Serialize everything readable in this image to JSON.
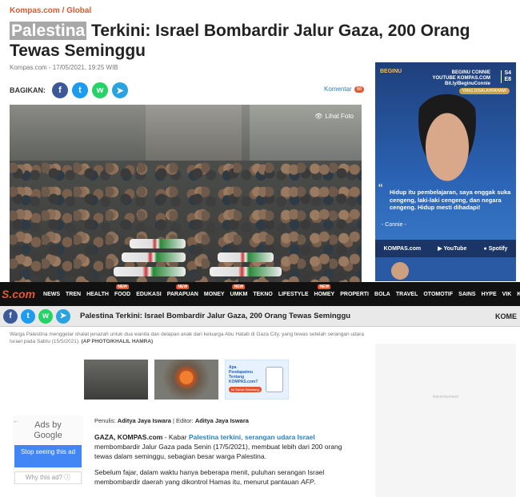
{
  "breadcrumb": {
    "site": "Kompas.com",
    "section": "Global"
  },
  "article": {
    "title_highlight": "Palestina",
    "title_rest": " Terkini: Israel Bombardir Jalur Gaza, 200 Orang Tewas Seminggu",
    "meta": "Kompas.com - 17/05/2021, 19:25 WIB",
    "share_label": "BAGIKAN:",
    "comment_label": "Komentar",
    "comment_count": "68",
    "photo_link": "Lihat Foto",
    "caption_text": "Warga Palestina menggelar shalat jenazah untuk dua wanita dan delapan anak dari keluarga Abu Hatab di Gaza City, yang tewas setelah serangan udara Israel pada Sabtu (15/5/2021).",
    "caption_credit": "(AP PHOTO/KHALIL HAMRA)",
    "writer": "Penulis:",
    "writer_name": "Aditya Jaya Iswara",
    "editor": "| Editor:",
    "editor_name": "Aditya Jaya Iswara",
    "dateline": "GAZA, KOMPAS.com",
    "p1_a": " - Kabar ",
    "p1_link1": "Palestina terkini",
    "p1_sep": ", ",
    "p1_link2": "serangan udara Israel",
    "p1_b": " membombardir Jalur Gaza pada Senin (17/5/2021), membuat lebih dari 200 orang tewas dalam seminggu, sebagian besar warga Palestina.",
    "p2_a": "Sebelum fajar, dalam waktu hanya beberapa menit, puluhan serangan Israel membombardir daerah yang dikontrol Hamas itu, menurut pantauan ",
    "p2_i": "AFP",
    "p2_b": "."
  },
  "share_icons": {
    "facebook": "f",
    "twitter": "t",
    "whatsapp": "w",
    "telegram": "➤"
  },
  "navbar": {
    "logo": "S.com",
    "items": [
      {
        "label": "NEWS",
        "new": ""
      },
      {
        "label": "TREN",
        "new": ""
      },
      {
        "label": "HEALTH",
        "new": ""
      },
      {
        "label": "FOOD",
        "new": "NEW"
      },
      {
        "label": "EDUKASI",
        "new": ""
      },
      {
        "label": "PARAPUAN",
        "new": "NEW"
      },
      {
        "label": "MONEY",
        "new": ""
      },
      {
        "label": "UMKM",
        "new": "NEW"
      },
      {
        "label": "TEKNO",
        "new": ""
      },
      {
        "label": "LIFESTYLE",
        "new": ""
      },
      {
        "label": "HOMEY",
        "new": "NEW"
      },
      {
        "label": "PROPERTI",
        "new": ""
      },
      {
        "label": "BOLA",
        "new": ""
      },
      {
        "label": "TRAVEL",
        "new": ""
      },
      {
        "label": "OTOMOTIF",
        "new": ""
      },
      {
        "label": "SAINS",
        "new": ""
      },
      {
        "label": "HYPE",
        "new": ""
      },
      {
        "label": "VIK",
        "new": ""
      },
      {
        "label": "KOL",
        "new": ""
      }
    ]
  },
  "sticky": {
    "title": "Palestina Terkini: Israel Bombardir Jalur Gaza, 200 Orang Tewas Seminggu",
    "right": "KOME"
  },
  "ad_right": {
    "logo": "BEGINU",
    "brand_line1": "BEGINU CONNIE",
    "brand_line2": "YOUTUBE KOMPAS.COM",
    "brand_line3": "Bit.ly/BeginuConnie",
    "season": "S4",
    "episode": "E8",
    "pill": "YANG DISALAHPAHAMI",
    "quote": "Hidup itu pembelajaran, saya enggak suka cengeng, laki-laki cengeng, dan negara cengeng. Hidup mesti dihadapi!",
    "author": "- Connie -",
    "bar_kompas": "KOMPAS.com",
    "bar_youtube": "YouTube",
    "bar_spotify": "Spotify"
  },
  "thumb3": {
    "text": "Apa Pendapatmu Tentang KOMPAS.com?",
    "button": "Isi Survei Sekarang"
  },
  "adsby": {
    "label_line1": "Ads by",
    "label_line2": "Google",
    "stop": "Stop seeing this ad",
    "why": "Why this ad? ⓘ"
  },
  "ad_right3": {
    "label": "Advertisement"
  },
  "colors": {
    "accent": "#e4572e",
    "link": "#2a7fc4",
    "navbar": "#111111",
    "google_blue": "#4285f4"
  }
}
